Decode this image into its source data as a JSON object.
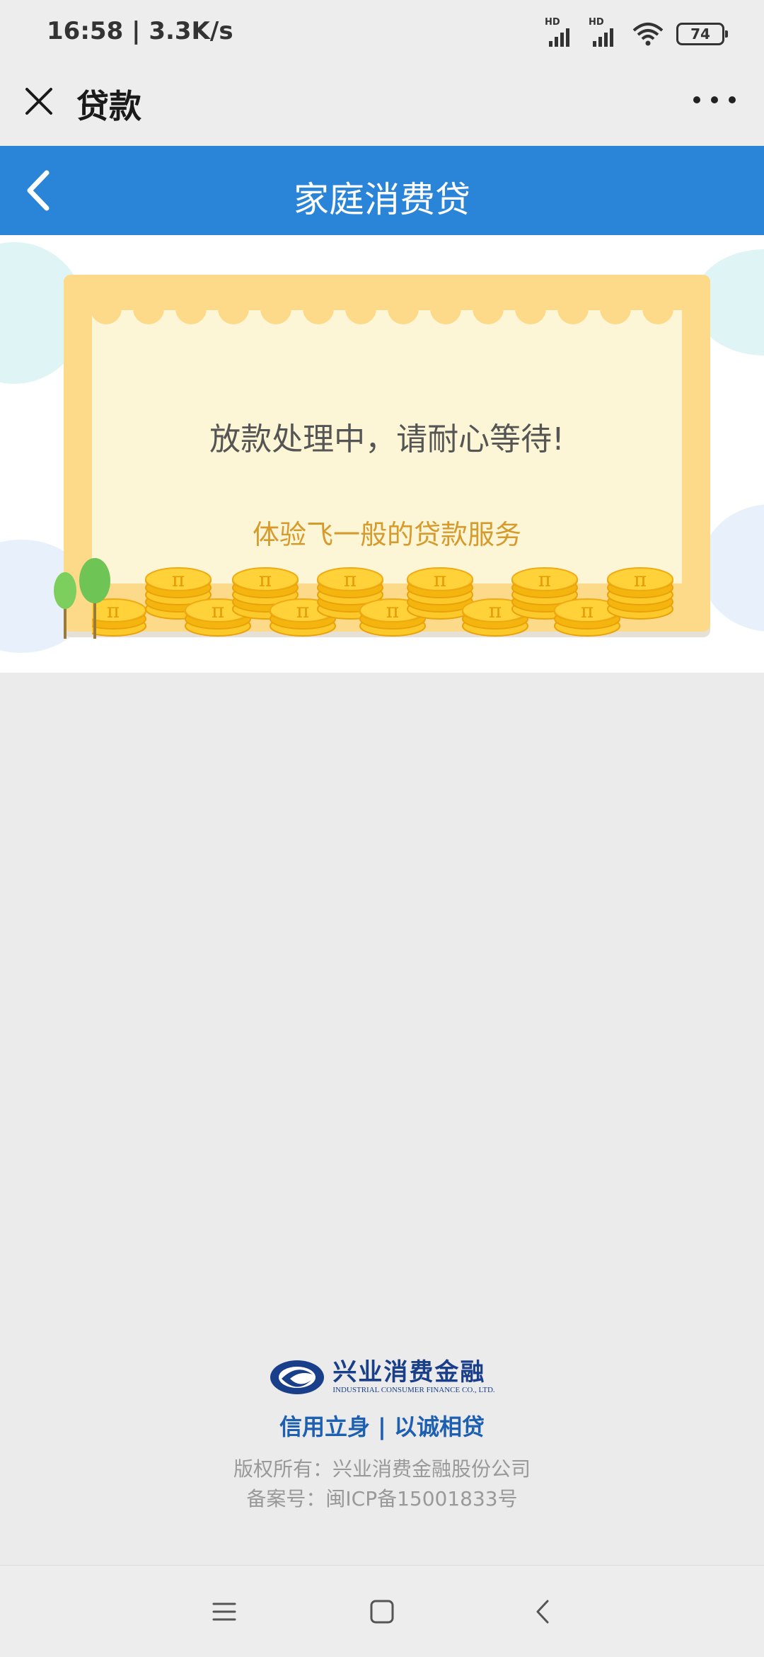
{
  "status_bar": {
    "time": "16:58 | 3.3K/s",
    "signal_label_1": "HD",
    "signal_label_2": "HD",
    "battery": "74"
  },
  "top_bar": {
    "title": "贷款",
    "close_icon": "close-icon",
    "more_icon": "more-dots-icon"
  },
  "header": {
    "title": "家庭消费贷",
    "back_icon": "chevron-left-icon",
    "color": "#2a84d8"
  },
  "card": {
    "message": "放款处理中，请耐心等待!",
    "subtitle": "体验飞一般的贷款服务",
    "coin_symbol": "π"
  },
  "footer": {
    "logo_cn": "兴业消费金融",
    "logo_en": "INDUSTRIAL CONSUMER FINANCE CO., LTD.",
    "slogan": "信用立身 | 以诚相贷",
    "copyright": "版权所有：兴业消费金融股份公司",
    "icp": "备案号：闽ICP备15001833号"
  },
  "nav_bar": {
    "menu_icon": "menu-icon",
    "home_icon": "home-square-icon",
    "back_icon": "back-triangle-icon"
  }
}
